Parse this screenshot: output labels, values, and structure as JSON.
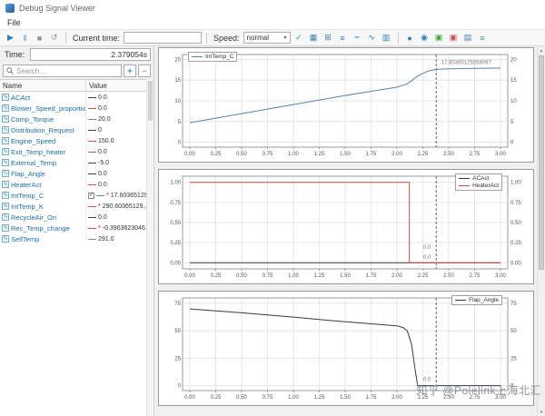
{
  "window": {
    "title": "Debug Signal Viewer"
  },
  "menu": {
    "file": "File"
  },
  "toolbar": {
    "current_time_label": "Current time:",
    "current_time_value": "",
    "speed_label": "Speed:",
    "speed_value": "normal",
    "playback": [
      {
        "name": "play",
        "glyph": "▶",
        "color": "#2d7dbb"
      },
      {
        "name": "pause",
        "glyph": "‖",
        "color": "#4a87b5"
      },
      {
        "name": "stop",
        "glyph": "■",
        "color": "#909090"
      },
      {
        "name": "restart",
        "glyph": "↺",
        "color": "#909090"
      }
    ],
    "view_icons": [
      {
        "name": "apply-speed",
        "glyph": "✓",
        "color": "#2e9b57"
      },
      {
        "name": "grid-view",
        "glyph": "▦",
        "color": "#3c7fb1"
      },
      {
        "name": "tile-view",
        "glyph": "⊞",
        "color": "#3c7fb1"
      },
      {
        "name": "line-style",
        "glyph": "≡",
        "color": "#2d7dbb"
      },
      {
        "name": "dashed-style",
        "glyph": "┉",
        "color": "#2d7dbb"
      },
      {
        "name": "wave-style",
        "glyph": "∿",
        "color": "#2d7dbb"
      },
      {
        "name": "bar-style",
        "glyph": "▥",
        "color": "#2d7dbb"
      }
    ],
    "right_icons": [
      {
        "name": "record",
        "glyph": "●",
        "color": "#2d7dbb"
      },
      {
        "name": "marker",
        "glyph": "◉",
        "color": "#2d7dbb"
      },
      {
        "name": "export-image",
        "glyph": "▣",
        "color": "#4ca64c"
      },
      {
        "name": "export-report",
        "glyph": "▣",
        "color": "#c0504d"
      },
      {
        "name": "table-view",
        "glyph": "▤",
        "color": "#3c7fb1"
      },
      {
        "name": "legend-toggle",
        "glyph": "≡",
        "color": "#2aa198"
      }
    ]
  },
  "left_panel": {
    "time_label": "Time:",
    "time_value": "2.379054s",
    "search_placeholder": "Search ...",
    "add_button": "+",
    "remove_button": "−",
    "columns": [
      "Name",
      "Value"
    ]
  },
  "signals": [
    {
      "name": "ACAct",
      "value": "0.0",
      "color": "#3f3f3f",
      "star": false,
      "checked": false
    },
    {
      "name": "Blower_Speed_proportion",
      "value": "0.0",
      "color": "#b9574e",
      "star": false,
      "checked": false
    },
    {
      "name": "Comp_Torque",
      "value": "20.0",
      "color": "#6f91b3",
      "star": false,
      "checked": false
    },
    {
      "name": "Distribution_Request",
      "value": "0",
      "color": "#3f3f3f",
      "star": false,
      "checked": false
    },
    {
      "name": "Engine_Speed",
      "value": "150.0",
      "color": "#b9574e",
      "star": false,
      "checked": false
    },
    {
      "name": "Exit_Temp_heater",
      "value": "0.0",
      "color": "#b9574e",
      "star": false,
      "checked": false
    },
    {
      "name": "External_Temp",
      "value": "-5.0",
      "color": "#3f3f3f",
      "star": false,
      "checked": false
    },
    {
      "name": "Flap_Angle",
      "value": "0.0",
      "color": "#3f3f3f",
      "star": false,
      "checked": false
    },
    {
      "name": "HeaterAct",
      "value": "0.0",
      "color": "#b9574e",
      "star": false,
      "checked": false
    },
    {
      "name": "IntTemp_C",
      "value": "17.60365129...",
      "color": "#5b84a8",
      "star": true,
      "checked": true
    },
    {
      "name": "IntTemp_K",
      "value": "290.60365129...",
      "color": "#b9574e",
      "star": true,
      "checked": false
    },
    {
      "name": "RecycleAir_On",
      "value": "0.0",
      "color": "#3f3f3f",
      "star": false,
      "checked": false
    },
    {
      "name": "Rec_Temp_change",
      "value": "-0.3963623046...",
      "color": "#b9574e",
      "star": true,
      "checked": false
    },
    {
      "name": "SelfTemp",
      "value": "291.0",
      "color": "#8a8a8a",
      "star": false,
      "checked": false
    }
  ],
  "chart_data": [
    {
      "id": "inttemp",
      "type": "line",
      "x_range": [
        -0.07,
        3.07
      ],
      "y_range": [
        -1.2,
        21.2
      ],
      "xticks": [
        {
          "v": 0,
          "label": "0.00"
        },
        {
          "v": 0.25,
          "label": "0.25"
        },
        {
          "v": 0.5,
          "label": "0.50"
        },
        {
          "v": 0.75,
          "label": "0.75"
        },
        {
          "v": 1,
          "label": "1.00"
        },
        {
          "v": 1.25,
          "label": "1.25"
        },
        {
          "v": 1.5,
          "label": "1.50"
        },
        {
          "v": 1.75,
          "label": "1.75"
        },
        {
          "v": 2,
          "label": "2.00"
        },
        {
          "v": 2.25,
          "label": "2.25"
        },
        {
          "v": 2.5,
          "label": "2.50"
        },
        {
          "v": 2.75,
          "label": "2.75"
        },
        {
          "v": 3,
          "label": "3.00"
        }
      ],
      "yticks": [
        {
          "v": 0,
          "label": "0"
        },
        {
          "v": 5,
          "label": "5"
        },
        {
          "v": 10,
          "label": "10"
        },
        {
          "v": 15,
          "label": "15"
        },
        {
          "v": 20,
          "label": "20"
        }
      ],
      "legend_pos": "tl",
      "cursor_x": 2.379054,
      "series": [
        {
          "name": "IntTemp_C",
          "color": "#5b84a8",
          "points": [
            [
              0,
              4.7
            ],
            [
              0.25,
              5.8
            ],
            [
              0.5,
              6.9
            ],
            [
              0.75,
              8.0
            ],
            [
              1.0,
              9.1
            ],
            [
              1.25,
              10.2
            ],
            [
              1.5,
              11.3
            ],
            [
              1.75,
              12.3
            ],
            [
              2.0,
              13.3
            ],
            [
              2.1,
              14.1
            ],
            [
              2.2,
              16.0
            ],
            [
              2.3,
              17.2
            ],
            [
              2.379,
              17.6
            ],
            [
              2.5,
              17.75
            ],
            [
              2.75,
              17.85
            ],
            [
              3.0,
              17.9
            ]
          ]
        }
      ],
      "annotations": [
        {
          "x": 2.41,
          "y": 18.9,
          "text": "17.60365129268097",
          "anchor": "start"
        }
      ]
    },
    {
      "id": "acact-heateract",
      "type": "line",
      "x_range": [
        -0.07,
        3.07
      ],
      "y_range": [
        -0.075,
        1.075
      ],
      "xticks": [
        {
          "v": 0,
          "label": "0.00"
        },
        {
          "v": 0.25,
          "label": "0.25"
        },
        {
          "v": 0.5,
          "label": "0.50"
        },
        {
          "v": 0.75,
          "label": "0.75"
        },
        {
          "v": 1,
          "label": "1.00"
        },
        {
          "v": 1.25,
          "label": "1.25"
        },
        {
          "v": 1.5,
          "label": "1.50"
        },
        {
          "v": 1.75,
          "label": "1.75"
        },
        {
          "v": 2,
          "label": "2.00"
        },
        {
          "v": 2.25,
          "label": "2.25"
        },
        {
          "v": 2.5,
          "label": "2.50"
        },
        {
          "v": 2.75,
          "label": "2.75"
        },
        {
          "v": 3,
          "label": "3.00"
        }
      ],
      "yticks": [
        {
          "v": 0,
          "label": "0.00"
        },
        {
          "v": 0.25,
          "label": "0.25"
        },
        {
          "v": 0.5,
          "label": "0.50"
        },
        {
          "v": 0.75,
          "label": "0.75"
        },
        {
          "v": 1,
          "label": "1.00"
        }
      ],
      "legend_pos": "tr",
      "cursor_x": 2.379054,
      "series": [
        {
          "name": "ACAct",
          "color": "#3a3a3a",
          "points": [
            [
              0,
              0
            ],
            [
              3,
              0
            ]
          ]
        },
        {
          "name": "HeaterAct",
          "color": "#c0504d",
          "points": [
            [
              0,
              1
            ],
            [
              2.12,
              1
            ],
            [
              2.12,
              0
            ],
            [
              3,
              0
            ]
          ]
        }
      ],
      "annotations": [
        {
          "x": 2.345,
          "y": 0.175,
          "text": "0.0",
          "anchor": "end"
        },
        {
          "x": 2.345,
          "y": 0.05,
          "text": "0.0",
          "anchor": "end"
        }
      ]
    },
    {
      "id": "flap-angle",
      "type": "line",
      "x_range": [
        -0.07,
        3.07
      ],
      "y_range": [
        -4.5,
        80
      ],
      "xticks": [
        {
          "v": 0,
          "label": "0.00"
        },
        {
          "v": 0.25,
          "label": "0.25"
        },
        {
          "v": 0.5,
          "label": "0.50"
        },
        {
          "v": 0.75,
          "label": "0.75"
        },
        {
          "v": 1,
          "label": "1.00"
        },
        {
          "v": 1.25,
          "label": "1.25"
        },
        {
          "v": 1.5,
          "label": "1.50"
        },
        {
          "v": 1.75,
          "label": "1.75"
        },
        {
          "v": 2,
          "label": "2.00"
        },
        {
          "v": 2.25,
          "label": "2.25"
        },
        {
          "v": 2.5,
          "label": "2.50"
        },
        {
          "v": 2.75,
          "label": "2.75"
        },
        {
          "v": 3,
          "label": "3.00"
        }
      ],
      "yticks": [
        {
          "v": 0,
          "label": "0"
        },
        {
          "v": 25,
          "label": "25"
        },
        {
          "v": 50,
          "label": "50"
        },
        {
          "v": 75,
          "label": "75"
        }
      ],
      "legend_pos": "tr",
      "cursor_x": 2.379054,
      "series": [
        {
          "name": "Flap_Angle",
          "color": "#3a3a3a",
          "points": [
            [
              0,
              70
            ],
            [
              0.25,
              68.2
            ],
            [
              0.5,
              66.4
            ],
            [
              0.75,
              64.5
            ],
            [
              1.0,
              62.5
            ],
            [
              1.25,
              60.4
            ],
            [
              1.5,
              58.3
            ],
            [
              1.75,
              56.4
            ],
            [
              2.0,
              54.6
            ],
            [
              2.06,
              53
            ],
            [
              2.1,
              50
            ],
            [
              2.14,
              38
            ],
            [
              2.18,
              12
            ],
            [
              2.2,
              0
            ],
            [
              3,
              0
            ]
          ]
        }
      ],
      "annotations": [
        {
          "x": 2.345,
          "y": 4,
          "text": "0.0",
          "anchor": "end"
        }
      ]
    }
  ],
  "watermark": "知乎 @Polelink上海北汇",
  "colors": {
    "accent": "#2d7dbb",
    "cursor": "#606060",
    "grid": "#e6e6e6"
  }
}
